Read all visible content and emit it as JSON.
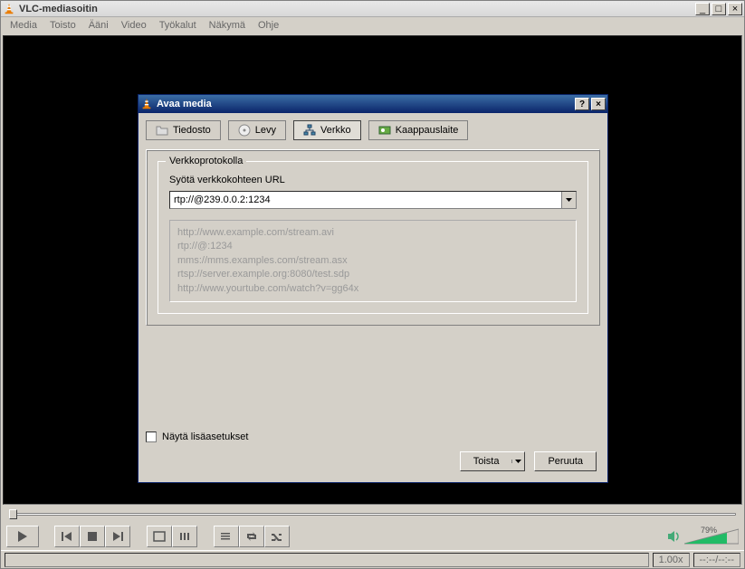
{
  "window": {
    "title": "VLC-mediasoitin",
    "controls": {
      "min": "_",
      "max": "□",
      "close": "×"
    }
  },
  "menu": [
    "Media",
    "Toisto",
    "Ääni",
    "Video",
    "Työkalut",
    "Näkymä",
    "Ohje"
  ],
  "dialog": {
    "title": "Avaa media",
    "help": "?",
    "close": "×",
    "tabs": [
      {
        "id": "file",
        "label": "Tiedosto"
      },
      {
        "id": "disc",
        "label": "Levy"
      },
      {
        "id": "network",
        "label": "Verkko"
      },
      {
        "id": "capture",
        "label": "Kaappauslaite"
      }
    ],
    "groupbox_legend": "Verkkoprotokolla",
    "url_label": "Syötä verkkokohteen URL",
    "url_value": "rtp://@239.0.0.2:1234",
    "examples": [
      "http://www.example.com/stream.avi",
      "rtp://@:1234",
      "mms://mms.examples.com/stream.asx",
      "rtsp://server.example.org:8080/test.sdp",
      "http://www.yourtube.com/watch?v=gg64x"
    ],
    "show_advanced": "Näytä lisäasetukset",
    "play_button": "Toista",
    "cancel_button": "Peruuta"
  },
  "playback": {
    "speed": "1.00x",
    "elapsed": "--:--",
    "total": "--:--",
    "volume_pct": "79%",
    "volume_value": 79
  }
}
